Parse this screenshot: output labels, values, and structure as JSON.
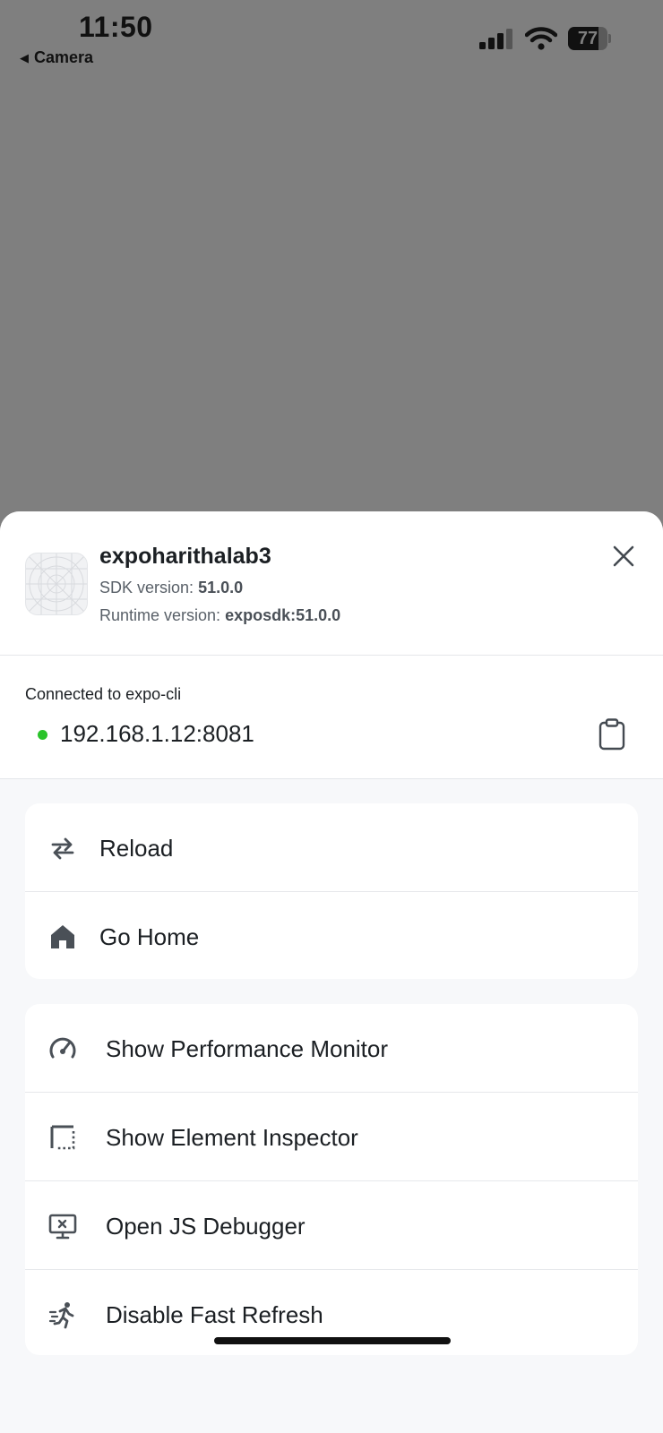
{
  "status_bar": {
    "time": "11:50",
    "back_label": "Camera",
    "battery_level": "77",
    "icons": [
      "signal-icon",
      "wifi-icon",
      "battery-icon"
    ]
  },
  "dev_menu": {
    "app_name": "expoharithalab3",
    "sdk_label": "SDK version:",
    "sdk_value": "51.0.0",
    "runtime_label": "Runtime version:",
    "runtime_value": "exposdk:51.0.0",
    "connection_label": "Connected to expo-cli",
    "connection_url": "192.168.1.12:8081",
    "connection_status_color": "#2bc32b",
    "primary_actions": [
      {
        "label": "Reload",
        "icon": "reload-icon"
      },
      {
        "label": "Go Home",
        "icon": "home-icon"
      }
    ],
    "tool_actions": [
      {
        "label": "Show Performance Monitor",
        "icon": "speedometer-icon"
      },
      {
        "label": "Show Element Inspector",
        "icon": "inspector-icon"
      },
      {
        "label": "Open JS Debugger",
        "icon": "debugger-icon"
      },
      {
        "label": "Disable Fast Refresh",
        "icon": "run-icon"
      }
    ]
  },
  "colors": {
    "backdrop": "#7f7f7f",
    "sheet_background": "#f7f8fa",
    "card_background": "#ffffff",
    "text_primary": "#1b1f23",
    "text_secondary": "#596068"
  }
}
